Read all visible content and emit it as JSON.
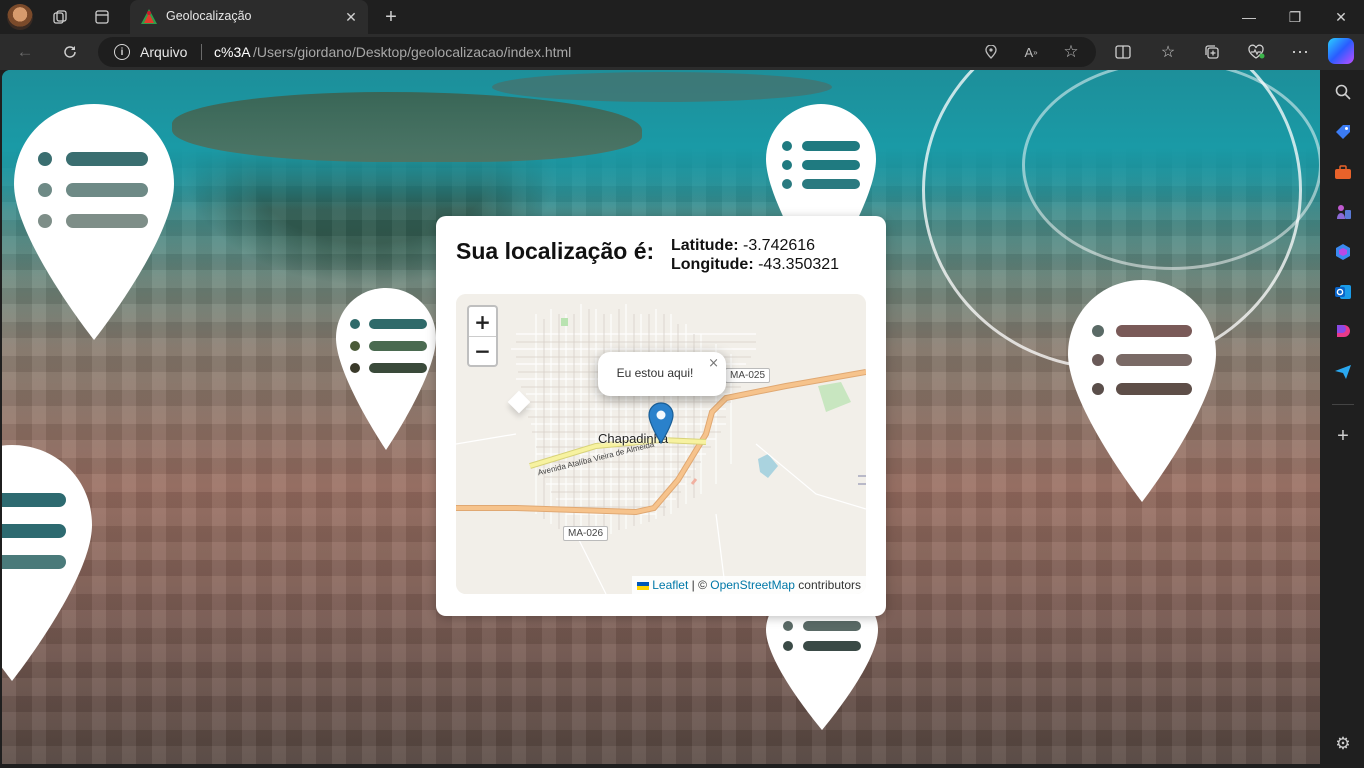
{
  "browser": {
    "tab_title": "Geolocalização",
    "site_chip": "Arquivo",
    "url_host": "c%3A",
    "url_path": "/Users/giordano/Desktop/geolocalizacao/index.html",
    "icons": {
      "workspaces": "workspaces-icon",
      "tab_actions": "tab-actions-icon",
      "back": "back-arrow-icon",
      "refresh": "refresh-icon",
      "info": "info-icon",
      "location": "location-pin-icon",
      "read_aloud": "read-aloud-icon",
      "favorite": "star-icon",
      "split_screen": "split-screen-icon",
      "favorites": "favorites-icon",
      "collections": "collections-icon",
      "performance": "heartbeat-icon",
      "more": "more-icon"
    }
  },
  "sidebar": {
    "items": [
      "search-icon",
      "shopping-tag-icon",
      "toolbox-icon",
      "games-icon",
      "copilot-icon",
      "outlook-icon",
      "designer-icon",
      "send-icon",
      "add-icon",
      "settings-icon"
    ]
  },
  "card": {
    "title": "Sua localização é:",
    "latitude_label": "Latitude:",
    "latitude_value": "-3.742616",
    "longitude_label": "Longitude:",
    "longitude_value": "-43.350321"
  },
  "map": {
    "zoom_in": "+",
    "zoom_out": "−",
    "popup_text": "Eu estou aqui!",
    "popup_close": "×",
    "city": "Chapadinha",
    "road_ma025": "MA-025",
    "road_ma026": "MA-026",
    "road_street": "Avenida Atalíba Vieira de Almeida",
    "attribution_leaflet": "Leaflet",
    "attribution_sep": " | © ",
    "attribution_osm": "OpenStreetMap",
    "attribution_tail": " contributors"
  },
  "colors": {
    "leaflet_marker": "#2a81cb",
    "road_major": "#f6c38c",
    "road_yellow": "#f7f2a0",
    "link": "#0078a8"
  }
}
